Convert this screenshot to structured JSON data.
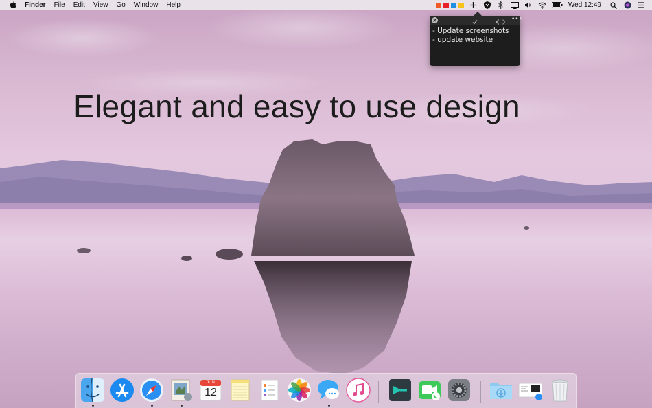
{
  "menubar": {
    "app_name": "Finder",
    "menus": [
      "File",
      "Edit",
      "View",
      "Go",
      "Window",
      "Help"
    ],
    "clock": "Wed 12:49",
    "status_icons": [
      "color-swatch-orange-icon",
      "color-swatch-red-icon",
      "color-swatch-blue-icon",
      "color-swatch-yellow-icon",
      "plus-icon",
      "shield-icon",
      "bluetooth-icon",
      "airplay-icon",
      "volume-icon",
      "wifi-icon",
      "battery-icon",
      "search-icon",
      "siri-icon",
      "list-icon"
    ],
    "swatch_colors": [
      "#f05a28",
      "#e8202a",
      "#1e8fe1",
      "#f6c21c"
    ]
  },
  "headline": "Elegant and easy to use design",
  "note": {
    "lines": [
      "- Update screenshots",
      "- update website"
    ]
  },
  "dock": {
    "apps": [
      "Finder",
      "App Store",
      "Safari",
      "Mail",
      "Calendar",
      "Notes",
      "Reminders",
      "Photos",
      "Messages",
      "iTunes",
      "Prompt",
      "FaceTime",
      "System Preferences"
    ],
    "calendar": {
      "month": "JUN",
      "day": "12"
    },
    "right_items": [
      "Downloads",
      "Screen",
      "Trash"
    ]
  }
}
